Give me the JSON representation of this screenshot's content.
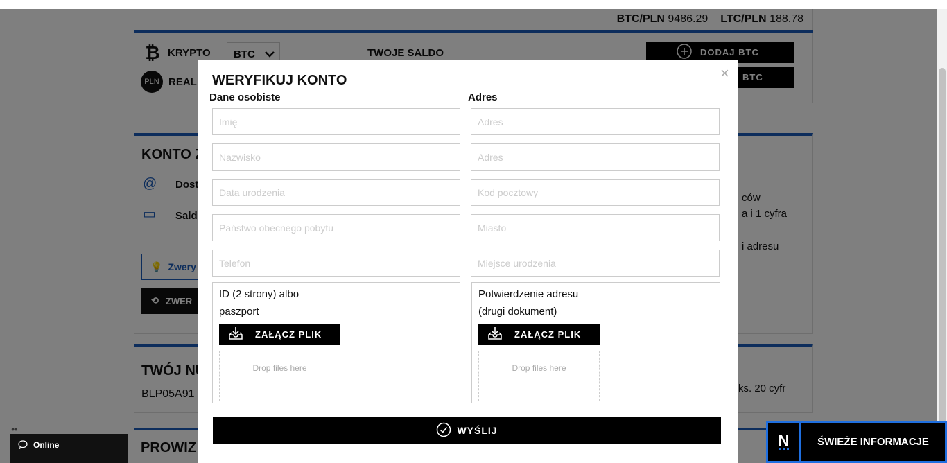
{
  "ticker": {
    "pair1_label": "BTC/PLN",
    "pair1_value": "9486.29",
    "pair2_label": "LTC/PLN",
    "pair2_value": "188.78"
  },
  "wallet": {
    "crypto_label": "KRYPTO",
    "crypto_selected": "BTC",
    "real_label": "REAL",
    "pln_badge": "PLN",
    "balance_label": "TWOJE SALDO",
    "add_btc": "DODAJ BTC",
    "second_btc": "BTC"
  },
  "account": {
    "title": "KONTO Z",
    "item1": "Dost",
    "item2": "Saldo",
    "verify_btn": "Zwery",
    "black_btn": "ZWER",
    "right_text1": "ców",
    "right_text2": "a i 1 cyfra",
    "right_text3": "i adresu"
  },
  "number_card": {
    "title": "TWÓJ NU",
    "value": "BLP05A91",
    "right_text": "ks. 20 cyfr"
  },
  "fees_card": {
    "title": "PROWIZ"
  },
  "chat": {
    "dots": "●●",
    "label": "Online"
  },
  "news": {
    "logo": "N",
    "label": "ŚWIEŻE INFORMACJE"
  },
  "modal": {
    "title": "WERYFIKUJ KONTO",
    "close": "×",
    "personal_heading": "Dane osobiste",
    "address_heading": "Adres",
    "personal_fields": [
      {
        "placeholder": "Imię"
      },
      {
        "placeholder": "Nazwisko"
      },
      {
        "placeholder": "Data urodzenia"
      },
      {
        "placeholder": "Państwo obecnego pobytu"
      },
      {
        "placeholder": "Telefon"
      }
    ],
    "address_fields": [
      {
        "placeholder": "Adres"
      },
      {
        "placeholder": "Adres"
      },
      {
        "placeholder": "Kod pocztowy"
      },
      {
        "placeholder": "Miasto"
      },
      {
        "placeholder": "Miejsce urodzenia"
      }
    ],
    "id_upload": {
      "label_line1": "ID (2 strony) albo",
      "label_line2": "paszport",
      "button": "ZAŁĄCZ PLIK",
      "drop": "Drop files here"
    },
    "address_upload": {
      "label_line1": "Potwierdzenie adresu",
      "label_line2": "(drugi dokument)",
      "button": "ZAŁĄCZ PLIK",
      "drop": "Drop files here"
    },
    "submit": "WYŚLIJ"
  }
}
